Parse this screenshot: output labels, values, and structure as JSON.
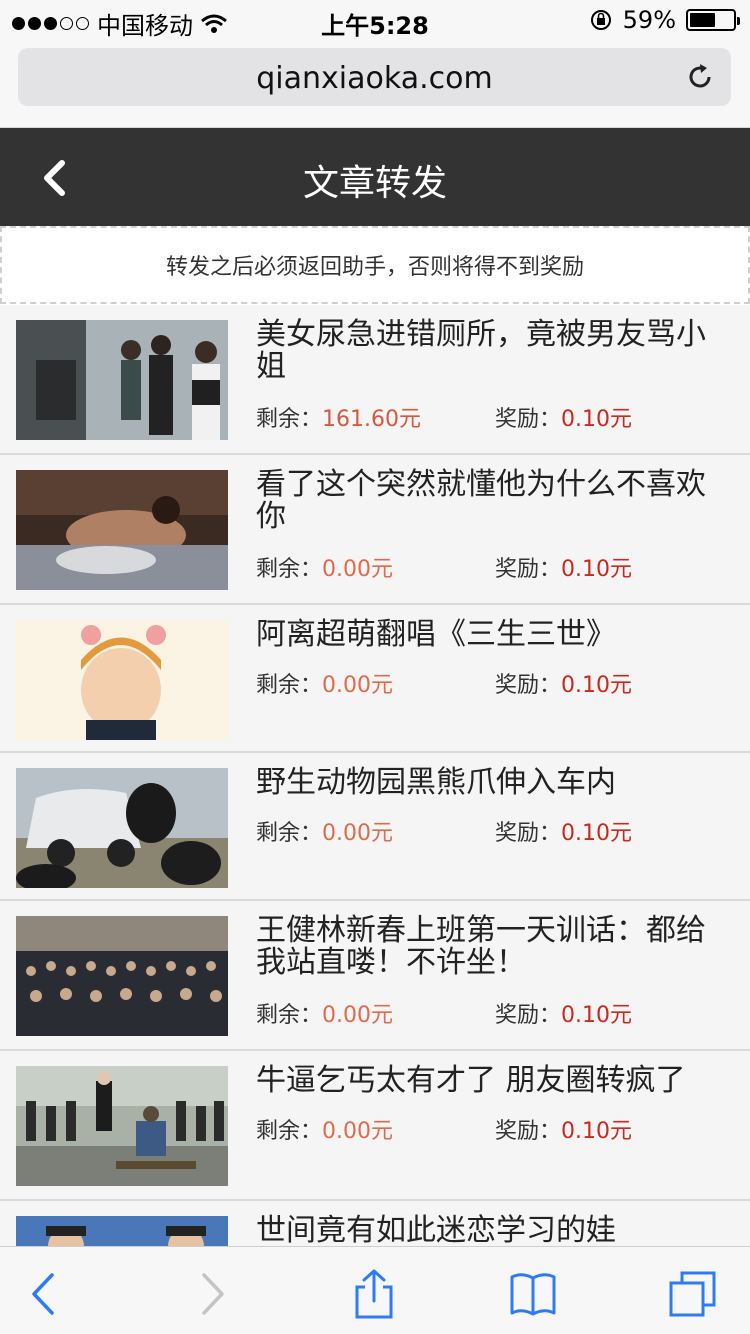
{
  "status": {
    "carrier": "中国移动",
    "time": "上午5:28",
    "battery_text": "59%",
    "battery_level": 0.59
  },
  "browser": {
    "url": "qianxiaoka.com"
  },
  "header": {
    "title": "文章转发"
  },
  "notice": "转发之后必须返回助手，否则将得不到奖励",
  "labels": {
    "remain": "剩余：",
    "reward": "奖励："
  },
  "articles": [
    {
      "title": "美女尿急进错厕所，竟被男友骂小姐",
      "remain": "161.60元",
      "reward": "0.10元"
    },
    {
      "title": "看了这个突然就懂他为什么不喜欢你",
      "remain": "0.00元",
      "reward": "0.10元"
    },
    {
      "title": "阿离超萌翻唱《三生三世》",
      "remain": "0.00元",
      "reward": "0.10元"
    },
    {
      "title": "野生动物园黑熊爪伸入车内",
      "remain": "0.00元",
      "reward": "0.10元"
    },
    {
      "title": "王健林新春上班第一天训话：都给我站直喽！不许坐！",
      "remain": "0.00元",
      "reward": "0.10元"
    },
    {
      "title": "牛逼乞丐太有才了 朋友圈转疯了",
      "remain": "0.00元",
      "reward": "0.10元"
    },
    {
      "title": "世间竟有如此迷恋学习的娃",
      "remain": "",
      "reward": ""
    }
  ],
  "colors": {
    "header_bg": "#333333",
    "remain_color": "#d25a3f",
    "reward_color": "#c82a1f",
    "ios_blue": "#2f7bf6"
  }
}
